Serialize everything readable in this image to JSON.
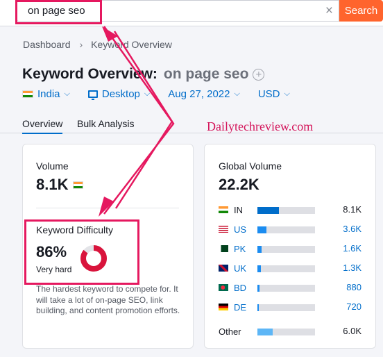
{
  "search": {
    "value": "on page seo",
    "button_label": "Search"
  },
  "breadcrumb": {
    "home": "Dashboard",
    "current": "Keyword Overview"
  },
  "page": {
    "title": "Keyword Overview:",
    "keyword": "on page seo"
  },
  "filters": {
    "country": "India",
    "device": "Desktop",
    "date": "Aug 27, 2022",
    "currency": "USD"
  },
  "tabs": [
    {
      "label": "Overview",
      "active": true
    },
    {
      "label": "Bulk Analysis",
      "active": false
    }
  ],
  "watermark": "Dailytechreview.com",
  "volume": {
    "label": "Volume",
    "value": "8.1K"
  },
  "keyword_difficulty": {
    "label": "Keyword Difficulty",
    "value": "86%",
    "level": "Very hard",
    "percent": 86,
    "description": "The hardest keyword to compete for. It will take a lot of on-page SEO, link building, and content promotion efforts."
  },
  "global_volume": {
    "label": "Global Volume",
    "value": "22.2K",
    "countries": [
      {
        "code": "IN",
        "value": "8.1K",
        "share": 0.37,
        "value_color": "#171a22",
        "code_color": "#171a22"
      },
      {
        "code": "US",
        "value": "3.6K",
        "share": 0.16,
        "value_color": "#006dca",
        "code_color": "#006dca"
      },
      {
        "code": "PK",
        "value": "1.6K",
        "share": 0.07,
        "value_color": "#006dca",
        "code_color": "#006dca"
      },
      {
        "code": "UK",
        "value": "1.3K",
        "share": 0.06,
        "value_color": "#006dca",
        "code_color": "#006dca"
      },
      {
        "code": "BD",
        "value": "880",
        "share": 0.04,
        "value_color": "#006dca",
        "code_color": "#006dca"
      },
      {
        "code": "DE",
        "value": "720",
        "share": 0.03,
        "value_color": "#006dca",
        "code_color": "#006dca"
      }
    ],
    "other": {
      "label": "Other",
      "value": "6.0K",
      "share": 0.27
    }
  },
  "colors": {
    "accent": "#006dca",
    "search_button": "#ff642d",
    "annotation": "#e5185f",
    "kd_ring": "#d9143c"
  }
}
